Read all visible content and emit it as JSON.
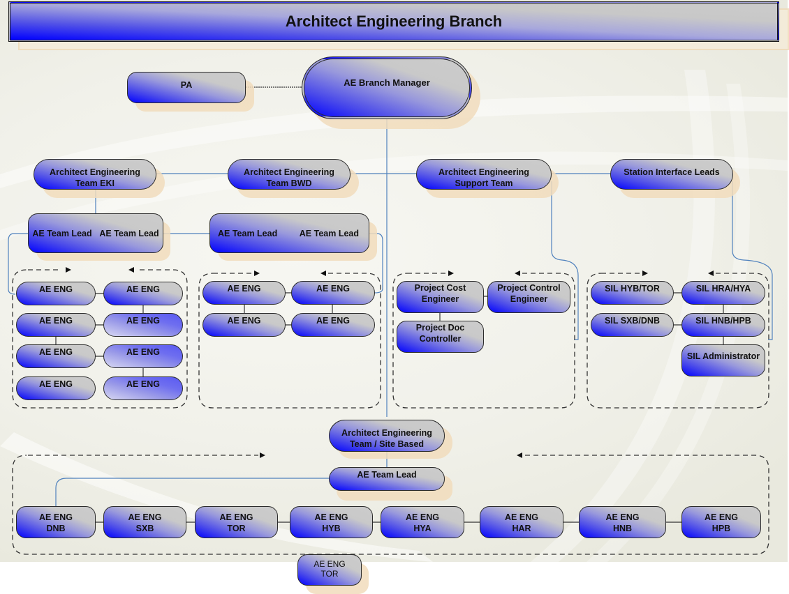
{
  "title": "Architect Engineering Branch",
  "top": {
    "pa": "PA",
    "manager": "AE Branch Manager"
  },
  "teams": [
    {
      "line1": "Architect Engineering",
      "line2": "Team EKI"
    },
    {
      "line1": "Architect Engineering",
      "line2": "Team BWD"
    },
    {
      "line1": "Architect Engineering",
      "line2": "Support Team"
    },
    {
      "line1": "Station Interface Leads",
      "line2": ""
    }
  ],
  "eki": {
    "leads": [
      "AE Team Lead",
      "AE Team Lead"
    ],
    "engineers": [
      "AE ENG",
      "AE ENG",
      "AE ENG",
      "AE ENG",
      "AE ENG",
      "AE ENG",
      "AE ENG",
      "AE ENG"
    ]
  },
  "bwd": {
    "leads": [
      "AE Team Lead",
      "AE Team Lead"
    ],
    "engineers": [
      "AE ENG",
      "AE ENG",
      "AE ENG",
      "AE ENG"
    ]
  },
  "support": {
    "members": [
      {
        "line1": "Project Cost",
        "line2": "Engineer"
      },
      {
        "line1": "Project Control",
        "line2": "Engineer"
      },
      {
        "line1": "Project Doc",
        "line2": "Controller"
      }
    ]
  },
  "sil": {
    "members": [
      "SIL HYB/TOR",
      "SIL HRA/HYA",
      "SIL SXB/DNB",
      "SIL HNB/HPB",
      "SIL Administrator"
    ]
  },
  "site": {
    "team": {
      "line1": "Architect Engineering",
      "line2": "Team / Site Based"
    },
    "lead": "AE Team Lead",
    "engineers": [
      {
        "line1": "AE ENG",
        "line2": "DNB"
      },
      {
        "line1": "AE ENG",
        "line2": "SXB"
      },
      {
        "line1": "AE ENG",
        "line2": "TOR"
      },
      {
        "line1": "AE ENG",
        "line2": "HYB"
      },
      {
        "line1": "AE ENG",
        "line2": "HYA"
      },
      {
        "line1": "AE ENG",
        "line2": "HAR"
      },
      {
        "line1": "AE ENG",
        "line2": "HNB"
      },
      {
        "line1": "AE ENG",
        "line2": "HPB"
      }
    ],
    "extra": {
      "line1": "AE ENG",
      "line2": "TOR"
    }
  },
  "colors": {
    "gradient_dark": "#0000ff",
    "gradient_light": "#cccccc",
    "connector": "#4f81bd",
    "shadow": "#f1dcbc",
    "background": "#f1f1ea"
  }
}
